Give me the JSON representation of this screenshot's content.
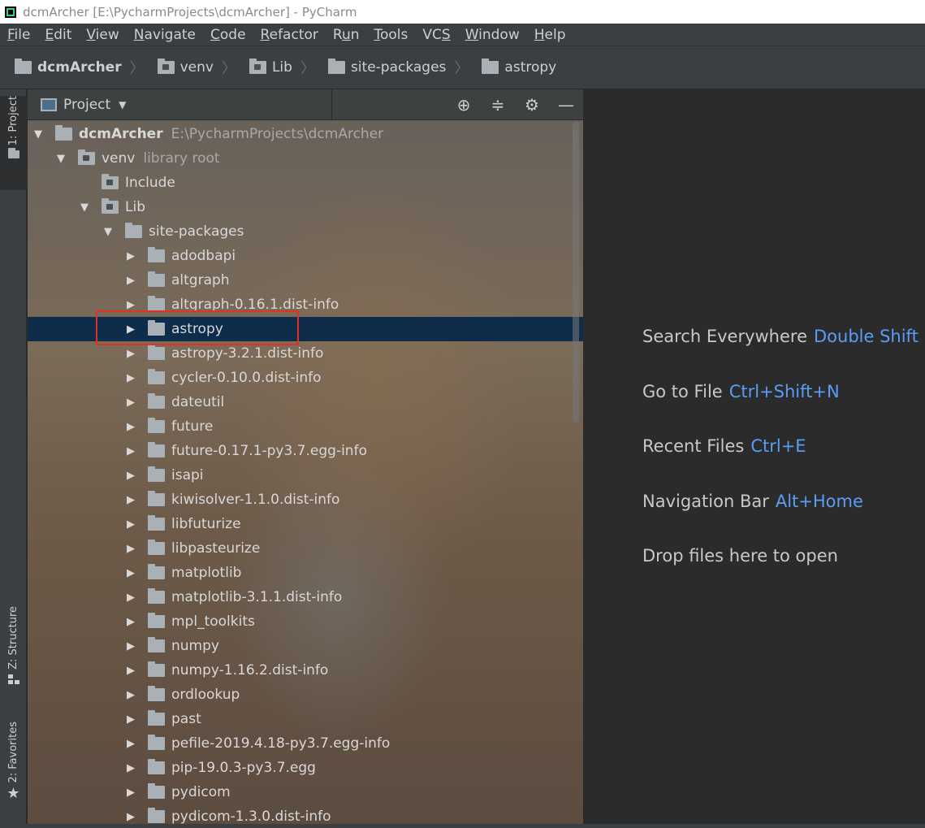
{
  "window": {
    "title": "dcmArcher [E:\\PycharmProjects\\dcmArcher] - PyCharm"
  },
  "menu": [
    {
      "u": "F",
      "rest": "ile"
    },
    {
      "u": "E",
      "rest": "dit"
    },
    {
      "u": "V",
      "rest": "iew"
    },
    {
      "u": "N",
      "rest": "avigate"
    },
    {
      "u": "C",
      "rest": "ode"
    },
    {
      "u": "R",
      "rest": "efactor"
    },
    {
      "pre": "R",
      "u": "u",
      "rest": "n"
    },
    {
      "u": "T",
      "rest": "ools"
    },
    {
      "pre": "VC",
      "u": "S",
      "rest": ""
    },
    {
      "u": "W",
      "rest": "indow"
    },
    {
      "u": "H",
      "rest": "elp"
    }
  ],
  "breadcrumb": [
    "dcmArcher",
    "venv",
    "Lib",
    "site-packages",
    "astropy"
  ],
  "side_tabs": {
    "project": "1: Project",
    "structure": "Z: Structure",
    "favorites": "2: Favorites"
  },
  "panel": {
    "title": "Project",
    "icons": [
      "locate-icon",
      "collapse-all-icon",
      "gear-icon",
      "minimize-icon"
    ]
  },
  "tree": {
    "root": {
      "name": "dcmArcher",
      "path": "E:\\PycharmProjects\\dcmArcher"
    },
    "venv": {
      "name": "venv",
      "note": "library root"
    },
    "include": "Include",
    "lib": "Lib",
    "site_packages": "site-packages",
    "packages": [
      "adodbapi",
      "altgraph",
      "altgraph-0.16.1.dist-info",
      "astropy",
      "astropy-3.2.1.dist-info",
      "cycler-0.10.0.dist-info",
      "dateutil",
      "future",
      "future-0.17.1-py3.7.egg-info",
      "isapi",
      "kiwisolver-1.1.0.dist-info",
      "libfuturize",
      "libpasteurize",
      "matplotlib",
      "matplotlib-3.1.1.dist-info",
      "mpl_toolkits",
      "numpy",
      "numpy-1.16.2.dist-info",
      "ordlookup",
      "past",
      "pefile-2019.4.18-py3.7.egg-info",
      "pip-19.0.3-py3.7.egg",
      "pydicom",
      "pydicom-1.3.0.dist-info"
    ],
    "selected": "astropy"
  },
  "editor_hints": [
    {
      "label": "Search Everywhere",
      "key": "Double Shift"
    },
    {
      "label": "Go to File",
      "key": "Ctrl+Shift+N"
    },
    {
      "label": "Recent Files",
      "key": "Ctrl+E"
    },
    {
      "label": "Navigation Bar",
      "key": "Alt+Home"
    },
    {
      "label": "Drop files here to open",
      "key": ""
    }
  ],
  "colors": {
    "selection": "#0d2d4b",
    "shortcut": "#589df6",
    "highlight_box": "#e0322b"
  }
}
